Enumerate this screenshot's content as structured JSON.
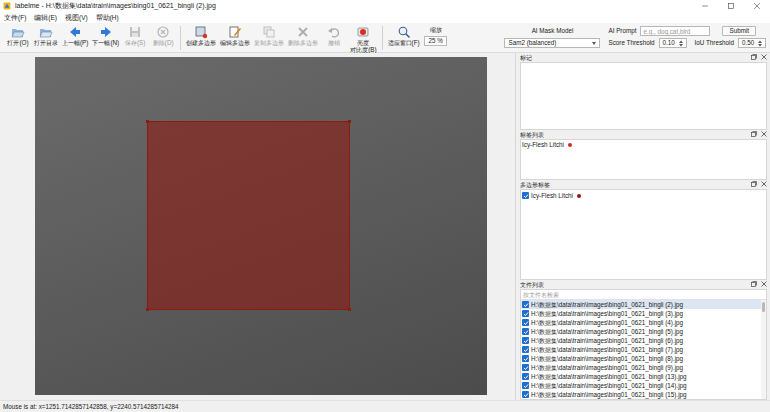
{
  "window": {
    "title": "labelme - H:\\数据集\\data\\train\\images\\bing01_0621_bingli (2).jpg"
  },
  "menu": [
    "文件(F)",
    "编辑(E)",
    "视图(V)",
    "帮助(H)"
  ],
  "toolbar": {
    "buttons": [
      {
        "lines": [
          "打开(O)"
        ],
        "disabled": false
      },
      {
        "lines": [
          "打开目录"
        ],
        "disabled": false
      },
      {
        "lines": [
          "上一幅(P)"
        ],
        "disabled": false
      },
      {
        "lines": [
          "下一幅(N)"
        ],
        "disabled": false
      },
      {
        "lines": [
          "保存(S)"
        ],
        "disabled": true
      },
      {
        "lines": [
          "删除(D)"
        ],
        "disabled": true
      },
      {
        "lines": [
          "创建多边形"
        ],
        "disabled": false
      },
      {
        "lines": [
          "编辑多边形"
        ],
        "disabled": false
      },
      {
        "lines": [
          "复制多边形"
        ],
        "disabled": true
      },
      {
        "lines": [
          "删除多边形"
        ],
        "disabled": true
      },
      {
        "lines": [
          "撤销"
        ],
        "disabled": true
      },
      {
        "lines": [
          "亮度",
          "对比度(B)"
        ],
        "disabled": false
      },
      {
        "lines": [
          "适应窗口(F)"
        ],
        "disabled": false
      }
    ]
  },
  "zoom": {
    "label": "缩放",
    "value": "25 %"
  },
  "ai_model": {
    "label": "AI Mask Model",
    "value": "Sam2 (balanced)"
  },
  "ai_prompt": {
    "label": "AI Prompt",
    "placeholder": "e.g., dog,cat,bird",
    "button": "Submit"
  },
  "thresholds": [
    {
      "label": "Score Threshold",
      "value": "0.10"
    },
    {
      "label": "IoU Threshold",
      "value": "0.50"
    }
  ],
  "flags_dock": {
    "title": "标记"
  },
  "label_list": {
    "title": "标签列表",
    "items": [
      {
        "text": "Icy-Flesh Litchi",
        "color": "#d42a1e"
      }
    ]
  },
  "polygon_labels": {
    "title": "多边形标签",
    "items": [
      {
        "text": "Icy-Flesh Litchi",
        "checked": true,
        "color": "#8e1a12"
      }
    ]
  },
  "file_list": {
    "title": "文件列表",
    "search_placeholder": "按文件名检索",
    "items": [
      {
        "text": "H:\\数据集\\data\\train\\images\\bing01_0621_bingli (2).jpg",
        "checked": true,
        "selected": true
      },
      {
        "text": "H:\\数据集\\data\\train\\images\\bing01_0621_bingli (3).jpg",
        "checked": true,
        "selected": false
      },
      {
        "text": "H:\\数据集\\data\\train\\images\\bing01_0621_bingli (4).jpg",
        "checked": true,
        "selected": false
      },
      {
        "text": "H:\\数据集\\data\\train\\images\\bing01_0621_bingli (5).jpg",
        "checked": true,
        "selected": false
      },
      {
        "text": "H:\\数据集\\data\\train\\images\\bing01_0621_bingli (6).jpg",
        "checked": true,
        "selected": false
      },
      {
        "text": "H:\\数据集\\data\\train\\images\\bing01_0621_bingli (7).jpg",
        "checked": true,
        "selected": false
      },
      {
        "text": "H:\\数据集\\data\\train\\images\\bing01_0621_bingli (8).jpg",
        "checked": true,
        "selected": false
      },
      {
        "text": "H:\\数据集\\data\\train\\images\\bing01_0621_bingli (9).jpg",
        "checked": true,
        "selected": false
      },
      {
        "text": "H:\\数据集\\data\\train\\images\\bing01_0621_bingli (13).jpg",
        "checked": true,
        "selected": false
      },
      {
        "text": "H:\\数据集\\data\\train\\images\\bing01_0621_bingli (14).jpg",
        "checked": true,
        "selected": false
      },
      {
        "text": "H:\\数据集\\data\\train\\images\\bing01_0621_bingli (15).jpg",
        "checked": true,
        "selected": false
      }
    ]
  },
  "status_bar": "Mouse is at: x=1251.7142857142858, y=2240.5714285714284"
}
